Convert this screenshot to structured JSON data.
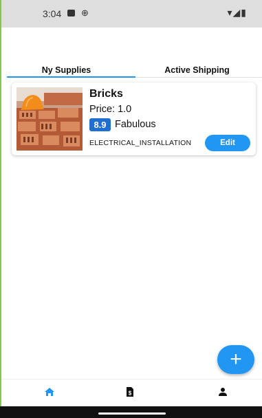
{
  "status_bar": {
    "time": "3:04",
    "right_glyphs": "▾◢▮"
  },
  "tabs": [
    {
      "label": "Ny Supplies",
      "selected": true
    },
    {
      "label": "Active Shipping",
      "selected": false
    }
  ],
  "supplies": [
    {
      "title": "Bricks",
      "price_text": "Price: 1.0",
      "rating_value": "8.9",
      "rating_label": "Fabulous",
      "category": "ELECTRICAL_INSTALLATION",
      "edit_label": "Edit",
      "image": "bricks-with-hardhat-photo"
    }
  ],
  "fab": {
    "glyph": "+"
  },
  "bottom_nav": [
    {
      "icon": "home-icon",
      "active": true
    },
    {
      "icon": "invoice-icon",
      "active": false
    },
    {
      "icon": "person-icon",
      "active": false
    }
  ],
  "colors": {
    "accent": "#2196f3",
    "rating_badge": "#1e6fd0",
    "status_bar": "#dedede"
  }
}
